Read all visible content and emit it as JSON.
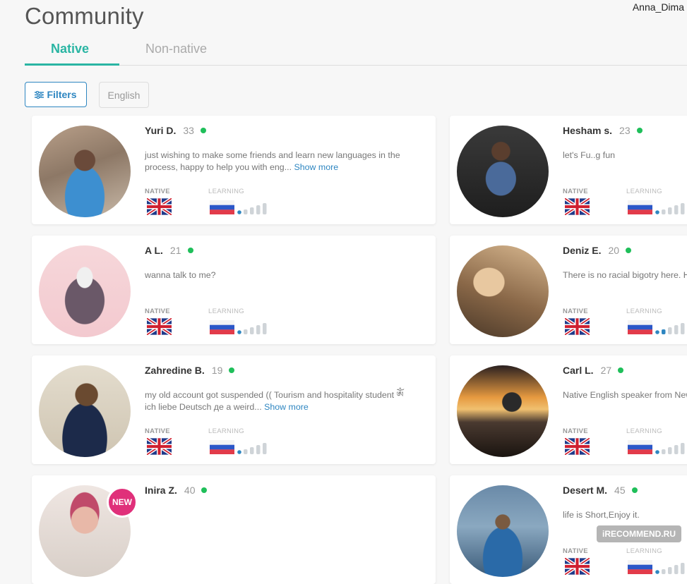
{
  "header": {
    "title": "Community",
    "username": "Anna_Dima"
  },
  "tabs": [
    {
      "label": "Native",
      "active": true
    },
    {
      "label": "Non-native",
      "active": false
    }
  ],
  "filters": {
    "button_label": "Filters",
    "language_chip": "English"
  },
  "labels": {
    "native": "NATIVE",
    "learning": "LEARNING",
    "show_more": "Show more",
    "new_badge": "NEW"
  },
  "users": [
    {
      "name": "Yuri D.",
      "age": "33",
      "bio": "just wishing to make some friends and learn new languages in the process, happy to help you with eng...",
      "show_more": true,
      "native": "uk",
      "learning": "ru",
      "level": 1,
      "online": true
    },
    {
      "name": "Hesham s.",
      "age": "23",
      "bio": "let's Fu..g fun",
      "show_more": false,
      "native": "uk",
      "learning": "ru",
      "level": 1,
      "online": true
    },
    {
      "name": "A L.",
      "age": "21",
      "bio": "wanna talk to me?",
      "show_more": false,
      "native": "uk",
      "learning": "ru",
      "level": 1,
      "online": true
    },
    {
      "name": "Deniz E.",
      "age": "20",
      "bio": "There is no racial bigotry here. H",
      "show_more": false,
      "native": "uk",
      "learning": "ru",
      "level": 2,
      "online": true
    },
    {
      "name": "Zahredine B.",
      "age": "19",
      "bio": "my old account got suspended (( Tourism and hospitality student ༀ ich liebe Deutsch де a weird...",
      "show_more": true,
      "native": "uk",
      "learning": "ru",
      "level": 1,
      "online": true
    },
    {
      "name": "Carl L.",
      "age": "27",
      "bio": "Native English speaker from New ☐☐ No, I am not fake ♀♂",
      "show_more": false,
      "native": "uk",
      "learning": "ru",
      "level": 1,
      "online": true
    },
    {
      "name": "Inira Z.",
      "age": "40",
      "bio": "",
      "show_more": false,
      "native": "uk",
      "learning": "ru",
      "level": 1,
      "online": true,
      "is_new": true
    },
    {
      "name": "Desert M.",
      "age": "45",
      "bio": "life is Short,Enjoy it.",
      "show_more": false,
      "native": "uk",
      "learning": "ru",
      "level": 1,
      "online": true
    }
  ],
  "watermark": "iRECOMMEND.RU",
  "colors": {
    "accent": "#2ab5a3",
    "link": "#2e86c1",
    "online": "#1fbf5a",
    "new_badge": "#e0307a"
  }
}
